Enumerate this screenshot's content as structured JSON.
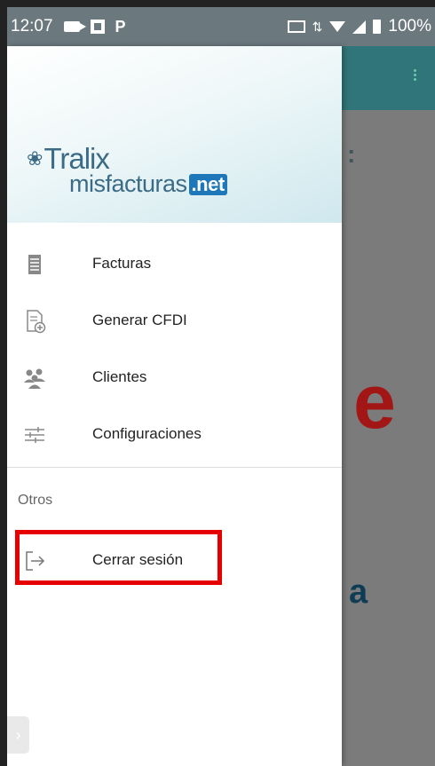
{
  "status_bar": {
    "time": "12:07",
    "battery": "100%"
  },
  "drawer": {
    "logo": {
      "brand": "Tralix",
      "product": "misfacturas",
      "tld": ".net"
    },
    "menu": [
      {
        "label": "Facturas",
        "icon": "document-list-icon"
      },
      {
        "label": "Generar CFDI",
        "icon": "document-add-icon"
      },
      {
        "label": "Clientes",
        "icon": "people-group-icon"
      },
      {
        "label": "Configuraciones",
        "icon": "sliders-icon"
      }
    ],
    "section_title": "Otros",
    "logout": {
      "label": "Cerrar sesión",
      "icon": "logout-icon"
    }
  },
  "background": {
    "letter_e": "e",
    "letter_a": "a"
  },
  "colors": {
    "app_bar": "#2f7579",
    "highlight": "#e60000",
    "brand": "#3b6b86",
    "net_badge": "#1d77b8"
  }
}
